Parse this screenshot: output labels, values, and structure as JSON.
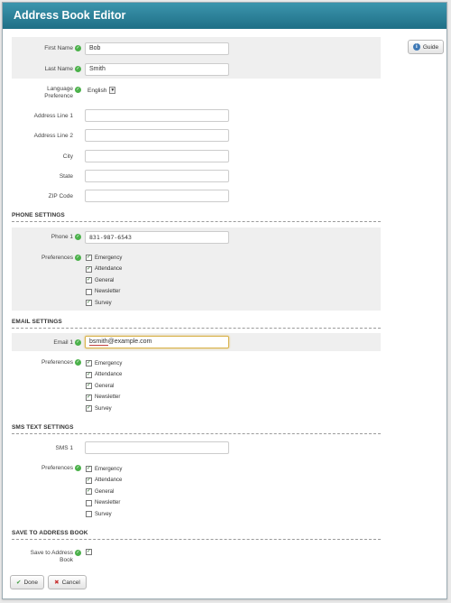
{
  "window": {
    "title": "Address Book Editor"
  },
  "toolbar": {
    "guide_label": "Guide"
  },
  "contact": {
    "first_name_label": "First Name",
    "first_name": "Bob",
    "last_name_label": "Last Name",
    "last_name": "Smith",
    "language_label": "Language Preference",
    "language": "English",
    "address1_label": "Address Line 1",
    "address1": "",
    "address2_label": "Address Line 2",
    "address2": "",
    "city_label": "City",
    "city": "",
    "state_label": "State",
    "state": "",
    "zip_label": "ZIP Code",
    "zip": ""
  },
  "phone": {
    "section_title": "PHONE SETTINGS",
    "phone1_label": "Phone 1",
    "phone1": "831-987-6543",
    "preferences_label": "Preferences",
    "preferences": [
      {
        "label": "Emergency",
        "checked": true
      },
      {
        "label": "Attendance",
        "checked": true
      },
      {
        "label": "General",
        "checked": true
      },
      {
        "label": "Newsletter",
        "checked": false
      },
      {
        "label": "Survey",
        "checked": true
      }
    ]
  },
  "email": {
    "section_title": "EMAIL SETTINGS",
    "email1_label": "Email 1",
    "email1_user": "bsmith",
    "email1_domain": "@example.com",
    "preferences_label": "Preferences",
    "preferences": [
      {
        "label": "Emergency",
        "checked": true
      },
      {
        "label": "Attendance",
        "checked": true
      },
      {
        "label": "General",
        "checked": true
      },
      {
        "label": "Newsletter",
        "checked": true
      },
      {
        "label": "Survey",
        "checked": true
      }
    ]
  },
  "sms": {
    "section_title": "SMS TEXT SETTINGS",
    "sms1_label": "SMS 1",
    "sms1": "",
    "preferences_label": "Preferences",
    "preferences": [
      {
        "label": "Emergency",
        "checked": true
      },
      {
        "label": "Attendance",
        "checked": true
      },
      {
        "label": "General",
        "checked": true
      },
      {
        "label": "Newsletter",
        "checked": false
      },
      {
        "label": "Survey",
        "checked": false
      }
    ]
  },
  "save": {
    "section_title": "SAVE TO ADDRESS BOOK",
    "label": "Save to Address Book",
    "checked": true
  },
  "actions": {
    "done_label": "Done",
    "cancel_label": "Cancel"
  },
  "colors": {
    "titlebar": "#2a7f98",
    "valid": "#4bb14a",
    "band": "#efefef"
  },
  "icons": {
    "valid": "checkmark-icon",
    "info": "info-icon",
    "done": "checkmark-icon",
    "cancel": "x-icon"
  }
}
